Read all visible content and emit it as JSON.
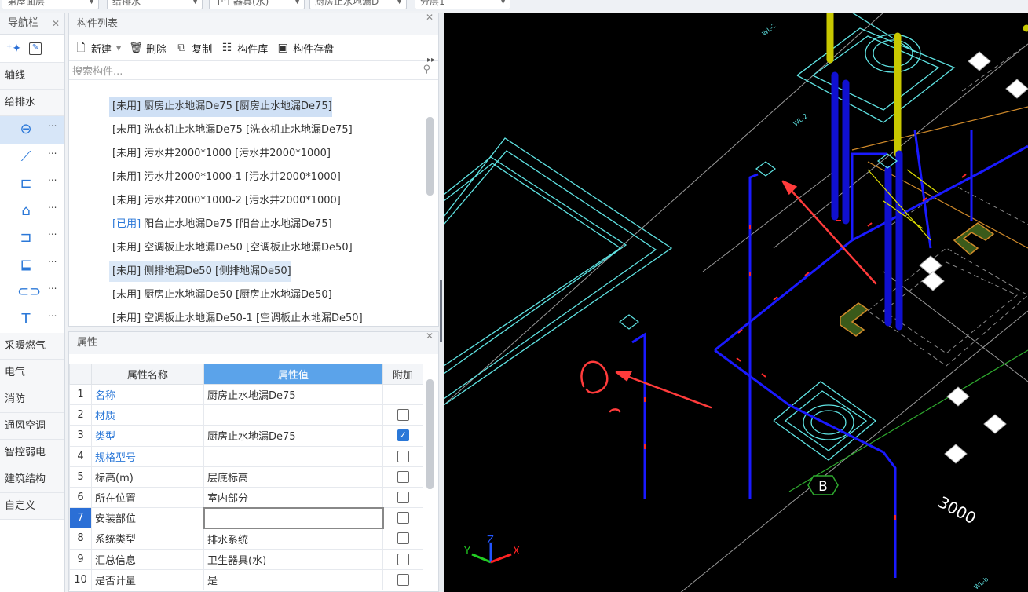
{
  "topbar": {
    "selects": [
      "第屋面层",
      "给排水",
      "卫生器具(水)",
      "厨房止水地漏D",
      "分层1"
    ]
  },
  "nav": {
    "title": "导航栏",
    "categories_top": [
      "轴线",
      "给排水"
    ],
    "categories_bottom": [
      "采暖燃气",
      "电气",
      "消防",
      "通风空调",
      "智控弱电",
      "建筑结构",
      "自定义"
    ],
    "more": "..."
  },
  "component_list": {
    "title": "构件列表",
    "toolbar": {
      "new": "新建",
      "delete": "删除",
      "copy": "复制",
      "library": "构件库",
      "save": "构件存盘"
    },
    "search_placeholder": "搜索构件...",
    "items": [
      {
        "status": "[未用]",
        "text": "厨房止水地漏De75 [厨房止水地漏De75]"
      },
      {
        "status": "[未用]",
        "text": "洗衣机止水地漏De75 [洗衣机止水地漏De75]"
      },
      {
        "status": "[未用]",
        "text": "污水井2000*1000 [污水井2000*1000]"
      },
      {
        "status": "[未用]",
        "text": "污水井2000*1000-1 [污水井2000*1000]"
      },
      {
        "status": "[未用]",
        "text": "污水井2000*1000-2 [污水井2000*1000]"
      },
      {
        "status": "[已用]",
        "text": "阳台止水地漏De75 [阳台止水地漏De75]"
      },
      {
        "status": "[未用]",
        "text": "空调板止水地漏De50 [空调板止水地漏De50]"
      },
      {
        "status": "[未用]",
        "text": "侧排地漏De50 [侧排地漏De50]"
      },
      {
        "status": "[未用]",
        "text": "厨房止水地漏De50 [厨房止水地漏De50]"
      },
      {
        "status": "[未用]",
        "text": "空调板止水地漏De50-1 [空调板止水地漏De50]"
      }
    ]
  },
  "properties": {
    "title": "属性",
    "headers": {
      "name": "属性名称",
      "value": "属性值",
      "extra": "附加"
    },
    "rows": [
      {
        "n": "1",
        "k": "名称",
        "v": "厨房止水地漏De75",
        "chk": null
      },
      {
        "n": "2",
        "k": "材质",
        "v": "",
        "chk": false
      },
      {
        "n": "3",
        "k": "类型",
        "v": "厨房止水地漏De75",
        "chk": true
      },
      {
        "n": "4",
        "k": "规格型号",
        "v": "",
        "chk": false
      },
      {
        "n": "5",
        "k": "标高(m)",
        "v": "层底标高",
        "chk": false
      },
      {
        "n": "6",
        "k": "所在位置",
        "v": "室内部分",
        "chk": false
      },
      {
        "n": "7",
        "k": "安装部位",
        "v": "",
        "chk": false
      },
      {
        "n": "8",
        "k": "系统类型",
        "v": "排水系统",
        "chk": false
      },
      {
        "n": "9",
        "k": "汇总信息",
        "v": "卫生器具(水)",
        "chk": false
      },
      {
        "n": "10",
        "k": "是否计量",
        "v": "是",
        "chk": false
      }
    ]
  },
  "cad": {
    "axis_label": "B",
    "dimension": "3000",
    "axes": {
      "y": "Y",
      "z": "Z",
      "x": "X"
    },
    "pipe_labels": [
      "WL-2",
      "WL-2",
      "WL-b"
    ]
  },
  "colors": {
    "accent": "#2b78d8",
    "cad_bg": "#000000",
    "pipe_blue": "#1a1aff",
    "pipe_yellow": "#c8c800",
    "cyan": "#5fe3e3",
    "annotation_red": "#ff3b3b"
  }
}
